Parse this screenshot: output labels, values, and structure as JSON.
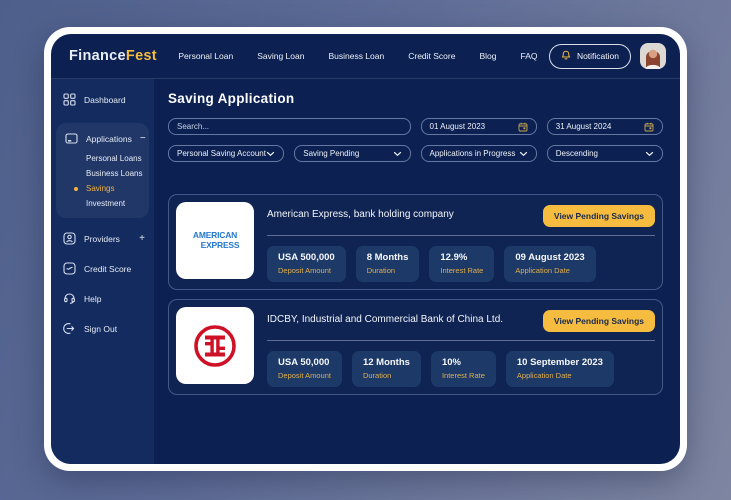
{
  "brand": {
    "primary": "Finance",
    "accent": "Fest"
  },
  "header": {
    "nav": [
      {
        "label": "Personal Loan"
      },
      {
        "label": "Saving Loan"
      },
      {
        "label": "Business Loan"
      },
      {
        "label": "Credit Score"
      },
      {
        "label": "Blog"
      },
      {
        "label": "FAQ"
      }
    ],
    "notification_label": "Notification"
  },
  "sidebar": {
    "dashboard": "Dashboard",
    "applications": {
      "label": "Applications",
      "collapse_sign": "−",
      "items": [
        {
          "label": "Personal Loans",
          "active": false
        },
        {
          "label": "Business Loans",
          "active": false
        },
        {
          "label": "Savings",
          "active": true
        },
        {
          "label": "Investment",
          "active": false
        }
      ]
    },
    "providers": {
      "label": "Providers",
      "expand_sign": "+"
    },
    "credit_score": "Credit Score",
    "help": "Help",
    "sign_out": "Sign Out"
  },
  "main": {
    "title": "Saving Application",
    "search_placeholder": "Search...",
    "date_from": "01 August 2023",
    "date_to": "31 August 2024",
    "dropdowns": [
      {
        "value": "Personal Saving Account"
      },
      {
        "value": "Saving Pending"
      },
      {
        "value": "Applications in Progress"
      },
      {
        "value": "Descending"
      }
    ],
    "cards": [
      {
        "bank": "American Express, bank holding company",
        "logo": "american-express",
        "button": "View Pending Savings",
        "stats": [
          {
            "value": "USA 500,000",
            "label": "Deposit Amount"
          },
          {
            "value": "8 Months",
            "label": "Duration"
          },
          {
            "value": "12.9%",
            "label": "Interest Rate"
          },
          {
            "value": "09 August 2023",
            "label": "Application Date"
          }
        ]
      },
      {
        "bank": "IDCBY, Industrial and Commercial Bank of China Ltd.",
        "logo": "icbc",
        "button": "View Pending Savings",
        "stats": [
          {
            "value": "USA 50,000",
            "label": "Deposit Amount"
          },
          {
            "value": "12 Months",
            "label": "Duration"
          },
          {
            "value": "10%",
            "label": "Interest Rate"
          },
          {
            "value": "10 September 2023",
            "label": "Application Date"
          }
        ]
      }
    ]
  },
  "amex_logo": {
    "line1": "AMERICAN",
    "line2": "EXPRESS"
  },
  "colors": {
    "accent_yellow": "#F5BC3F",
    "navy": "#0C2151",
    "sidebar_navy": "#132B5E",
    "chip_navy": "#1D3967",
    "amex_blue": "#2478CC",
    "icbc_red": "#CE1126"
  }
}
